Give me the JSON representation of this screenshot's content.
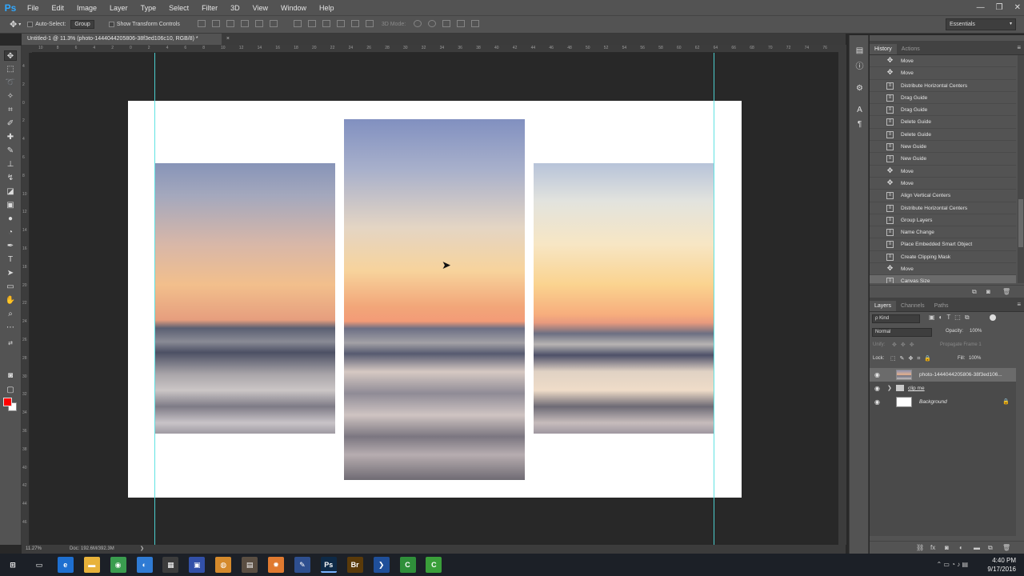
{
  "app": {
    "logo": "Ps",
    "menu": [
      "File",
      "Edit",
      "Image",
      "Layer",
      "Type",
      "Select",
      "Filter",
      "3D",
      "View",
      "Window",
      "Help"
    ],
    "window_controls": [
      "—",
      "❐",
      "✕"
    ]
  },
  "options": {
    "auto_select_label": "Auto-Select:",
    "auto_select_value": "Group",
    "show_transform_label": "Show Transform Controls",
    "mode_3d_label": "3D Mode:",
    "workspace": "Essentials"
  },
  "document": {
    "tab_title": "Untitled-1 @ 11.3% (photo-1444044205806-38f3ed106c10, RGB/8) *",
    "tab_close": "×",
    "ruler_top_labels": [
      "10",
      "8",
      "6",
      "4",
      "2",
      "0",
      "2",
      "4",
      "6",
      "8",
      "10",
      "12",
      "14",
      "16",
      "18",
      "20",
      "22",
      "24",
      "26",
      "28",
      "30",
      "32",
      "34",
      "36",
      "38",
      "40",
      "42",
      "44",
      "46",
      "48",
      "50",
      "52",
      "54",
      "56",
      "58",
      "60",
      "62",
      "64",
      "66",
      "68",
      "70",
      "72",
      "74",
      "76",
      "78"
    ],
    "ruler_left_labels": [
      "4",
      "2",
      "0",
      "2",
      "4",
      "6",
      "8",
      "10",
      "12",
      "14",
      "16",
      "18",
      "20",
      "22",
      "24",
      "26",
      "28",
      "30",
      "32",
      "34",
      "36",
      "38",
      "40",
      "42",
      "44",
      "46"
    ]
  },
  "status": {
    "zoom": "11.27%",
    "doc_info": "Doc: 192.6M/392.3M",
    "arrow": "❯"
  },
  "history": {
    "tab_active": "History",
    "tab_other": "Actions",
    "items": [
      {
        "label": "Move",
        "icon": "move"
      },
      {
        "label": "Move",
        "icon": "move"
      },
      {
        "label": "Distribute Horizontal Centers",
        "icon": "doc"
      },
      {
        "label": "Drag Guide",
        "icon": "doc"
      },
      {
        "label": "Drag Guide",
        "icon": "doc"
      },
      {
        "label": "Delete Guide",
        "icon": "doc"
      },
      {
        "label": "Delete Guide",
        "icon": "doc"
      },
      {
        "label": "New Guide",
        "icon": "doc"
      },
      {
        "label": "New Guide",
        "icon": "doc"
      },
      {
        "label": "Move",
        "icon": "move"
      },
      {
        "label": "Move",
        "icon": "move"
      },
      {
        "label": "Align Vertical Centers",
        "icon": "doc"
      },
      {
        "label": "Distribute Horizontal Centers",
        "icon": "doc"
      },
      {
        "label": "Group Layers",
        "icon": "doc"
      },
      {
        "label": "Name Change",
        "icon": "doc"
      },
      {
        "label": "Place Embedded Smart Object",
        "icon": "doc"
      },
      {
        "label": "Create Clipping Mask",
        "icon": "doc"
      },
      {
        "label": "Move",
        "icon": "move"
      },
      {
        "label": "Canvas Size",
        "icon": "doc",
        "selected": true
      }
    ]
  },
  "layers": {
    "tabs": [
      "Layers",
      "Channels",
      "Paths"
    ],
    "kind_label": "ρ Kind",
    "blend_mode": "Normal",
    "opacity_label": "Opacity:",
    "opacity_value": "100%",
    "unify_label": "Unify:",
    "propagate_label": "Propagate Frame 1",
    "lock_label": "Lock:",
    "fill_label": "Fill:",
    "fill_value": "100%",
    "items": [
      {
        "name": "photo-1444044205806-38f3ed106...",
        "type": "smart",
        "selected": true
      },
      {
        "name": "clip me",
        "type": "group"
      },
      {
        "name": "Background",
        "type": "background"
      }
    ]
  },
  "taskbar": {
    "apps": [
      {
        "name": "start",
        "glyph": "⊞",
        "color": "#1c2027"
      },
      {
        "name": "task-view",
        "glyph": "▭",
        "color": "#1c2027"
      },
      {
        "name": "edge",
        "glyph": "e",
        "color": "#1e6fd0"
      },
      {
        "name": "explorer",
        "glyph": "▬",
        "color": "#e8b23a"
      },
      {
        "name": "chrome",
        "glyph": "◉",
        "color": "#3a9d4f"
      },
      {
        "name": "photos",
        "glyph": "◐",
        "color": "#2f7bd4"
      },
      {
        "name": "calculator",
        "glyph": "▦",
        "color": "#3c3c3c"
      },
      {
        "name": "app-blue",
        "glyph": "▣",
        "color": "#3250a8"
      },
      {
        "name": "app-round",
        "glyph": "◍",
        "color": "#d58a2c"
      },
      {
        "name": "app-box",
        "glyph": "▤",
        "color": "#5a4e42"
      },
      {
        "name": "settings",
        "glyph": "✹",
        "color": "#e07a30"
      },
      {
        "name": "app-tool",
        "glyph": "✎",
        "color": "#2e4f8f"
      },
      {
        "name": "photoshop",
        "glyph": "Ps",
        "color": "#0e2a47",
        "active": true
      },
      {
        "name": "bridge",
        "glyph": "Br",
        "color": "#5a3a0a"
      },
      {
        "name": "powershell",
        "glyph": "❯",
        "color": "#1f4f9a"
      },
      {
        "name": "camtasia-green",
        "glyph": "C",
        "color": "#2f8f3a"
      },
      {
        "name": "camtasia",
        "glyph": "C",
        "color": "#3a9f3a"
      }
    ],
    "time": "4:40 PM",
    "date": "9/17/2016"
  }
}
